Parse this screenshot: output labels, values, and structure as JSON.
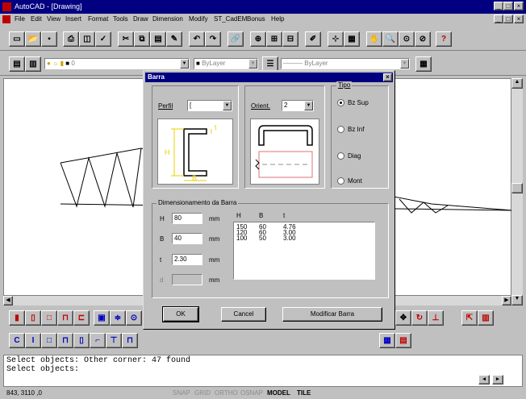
{
  "window": {
    "title": "AutoCAD - [Drawing]"
  },
  "menu": [
    "File",
    "Edit",
    "View",
    "Insert",
    "Format",
    "Tools",
    "Draw",
    "Dimension",
    "Modify",
    "ST_CadEM",
    "Bonus",
    "Help"
  ],
  "layer": {
    "name": "0",
    "linetype": "ByLayer",
    "linetype2": "ByLayer",
    "color": "ByLayer"
  },
  "command": {
    "lines": [
      "Select objects: Other corner: 47 found",
      "Select objects:"
    ]
  },
  "status": {
    "coords": "843, 3110 ,0",
    "buttons": [
      "SNAP",
      "GRID",
      "ORTHO",
      "OSNAP",
      "MODEL",
      "TILE"
    ]
  },
  "dialog": {
    "title": "Barra",
    "perfil_label": "Perfil",
    "perfil_value": "[",
    "orient_label": "Orient.",
    "orient_value": "2",
    "profile_dims": {
      "h": "H",
      "b": "B",
      "t": "t"
    },
    "tipo": {
      "label": "Tipo",
      "options": [
        "Bz Sup",
        "Bz Inf",
        "Diag",
        "Mont"
      ],
      "selected": 0
    },
    "dim_group_label": "Dimensionamento da Barra",
    "fields": [
      {
        "label": "H",
        "value": "80",
        "unit": "mm"
      },
      {
        "label": "B",
        "value": "40",
        "unit": "mm"
      },
      {
        "label": "t",
        "value": "2.30",
        "unit": "mm"
      },
      {
        "label": "d",
        "value": "",
        "unit": "mm"
      }
    ],
    "table": {
      "headers": [
        "H",
        "B",
        "t"
      ],
      "rows": [
        [
          "150",
          "60",
          "4.76"
        ],
        [
          "120",
          "60",
          "3.00"
        ],
        [
          "100",
          "50",
          "3.00"
        ]
      ]
    },
    "ok_label": "OK",
    "cancel_label": "Cancel",
    "modify_label": "Modificar Barra"
  }
}
